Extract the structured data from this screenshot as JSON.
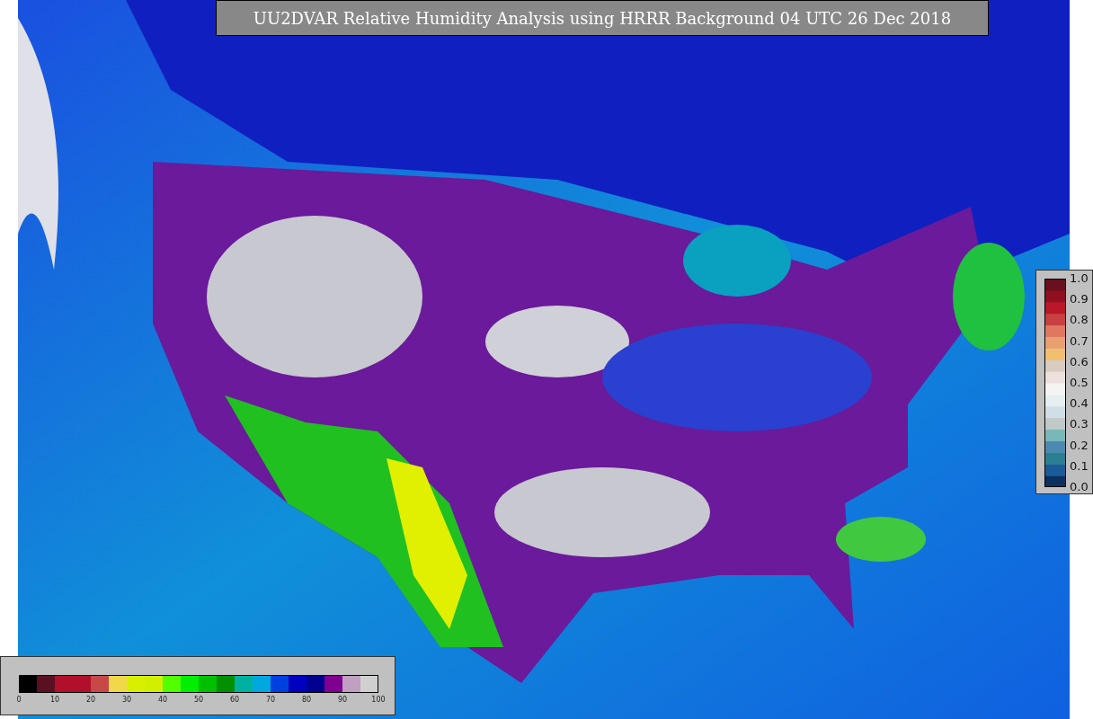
{
  "title": "UU2DVAR Relative Humidity Analysis using HRRR Background 04 UTC 26 Dec 2018",
  "humidity_colorbar": {
    "ticks": [
      "0",
      "10",
      "20",
      "30",
      "40",
      "50",
      "60",
      "70",
      "80",
      "90",
      "100"
    ]
  },
  "ratio_colorbar": {
    "ticks": [
      "1.0",
      "0.9",
      "0.8",
      "0.7",
      "0.6",
      "0.5",
      "0.4",
      "0.3",
      "0.2",
      "0.1",
      "0.0"
    ]
  }
}
